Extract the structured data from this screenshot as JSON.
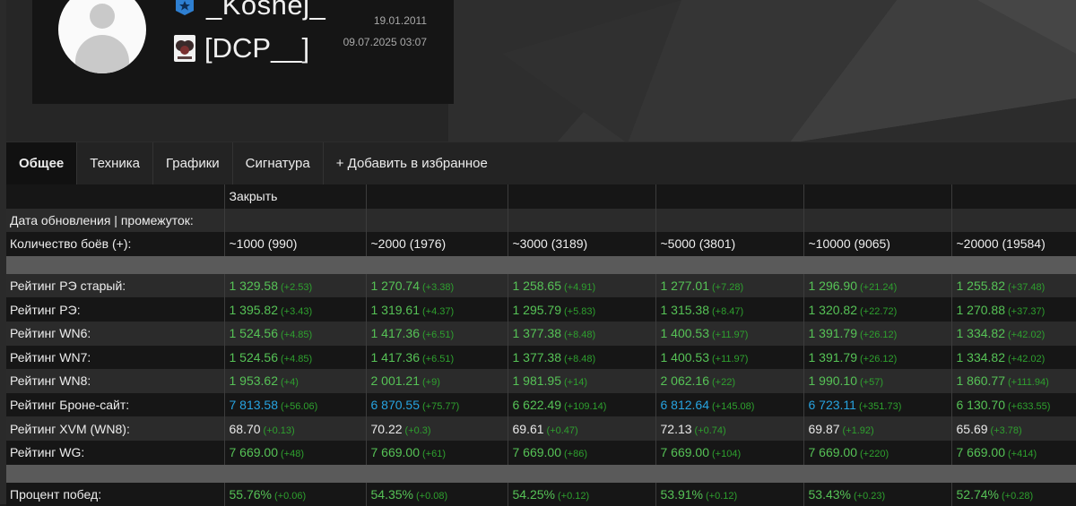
{
  "profile": {
    "nickname": "_Koshej_",
    "clan": "[DCP__]",
    "reg_date": "19.01.2011",
    "last_battle": "09.07.2025 03:07"
  },
  "tabs": [
    "Общее",
    "Техника",
    "Графики",
    "Сигнатура",
    "+ Добавить в избранное"
  ],
  "table": {
    "close_label": "Закрыть",
    "update_label": "Дата обновления | промежуток:",
    "battles_label": "Количество боёв (+):",
    "periods": [
      "~1000 (990)",
      "~2000 (1976)",
      "~3000 (3189)",
      "~5000 (3801)",
      "~10000 (9065)",
      "~20000 (19584)"
    ],
    "rows": [
      {
        "label": "Рейтинг РЭ старый:",
        "cells": [
          {
            "v": "1 329.58",
            "d": "(+2.53)",
            "c": "green"
          },
          {
            "v": "1 270.74",
            "d": "(+3.38)",
            "c": "green"
          },
          {
            "v": "1 258.65",
            "d": "(+4.91)",
            "c": "green"
          },
          {
            "v": "1 277.01",
            "d": "(+7.28)",
            "c": "green"
          },
          {
            "v": "1 296.90",
            "d": "(+21.24)",
            "c": "green"
          },
          {
            "v": "1 255.82",
            "d": "(+37.48)",
            "c": "green"
          }
        ]
      },
      {
        "label": "Рейтинг РЭ:",
        "cells": [
          {
            "v": "1 395.82",
            "d": "(+3.43)",
            "c": "green"
          },
          {
            "v": "1 319.61",
            "d": "(+4.37)",
            "c": "green"
          },
          {
            "v": "1 295.79",
            "d": "(+5.83)",
            "c": "green"
          },
          {
            "v": "1 315.38",
            "d": "(+8.47)",
            "c": "green"
          },
          {
            "v": "1 320.82",
            "d": "(+22.72)",
            "c": "green"
          },
          {
            "v": "1 270.88",
            "d": "(+37.37)",
            "c": "green"
          }
        ]
      },
      {
        "label": "Рейтинг WN6:",
        "cells": [
          {
            "v": "1 524.56",
            "d": "(+4.85)",
            "c": "green"
          },
          {
            "v": "1 417.36",
            "d": "(+6.51)",
            "c": "green"
          },
          {
            "v": "1 377.38",
            "d": "(+8.48)",
            "c": "green"
          },
          {
            "v": "1 400.53",
            "d": "(+11.97)",
            "c": "green"
          },
          {
            "v": "1 391.79",
            "d": "(+26.12)",
            "c": "green"
          },
          {
            "v": "1 334.82",
            "d": "(+42.02)",
            "c": "green"
          }
        ]
      },
      {
        "label": "Рейтинг WN7:",
        "cells": [
          {
            "v": "1 524.56",
            "d": "(+4.85)",
            "c": "green"
          },
          {
            "v": "1 417.36",
            "d": "(+6.51)",
            "c": "green"
          },
          {
            "v": "1 377.38",
            "d": "(+8.48)",
            "c": "green"
          },
          {
            "v": "1 400.53",
            "d": "(+11.97)",
            "c": "green"
          },
          {
            "v": "1 391.79",
            "d": "(+26.12)",
            "c": "green"
          },
          {
            "v": "1 334.82",
            "d": "(+42.02)",
            "c": "green"
          }
        ]
      },
      {
        "label": "Рейтинг WN8:",
        "cells": [
          {
            "v": "1 953.62",
            "d": "(+4)",
            "c": "green"
          },
          {
            "v": "2 001.21",
            "d": "(+9)",
            "c": "green"
          },
          {
            "v": "1 981.95",
            "d": "(+14)",
            "c": "green"
          },
          {
            "v": "2 062.16",
            "d": "(+22)",
            "c": "green"
          },
          {
            "v": "1 990.10",
            "d": "(+57)",
            "c": "green"
          },
          {
            "v": "1 860.77",
            "d": "(+111.94)",
            "c": "green"
          }
        ]
      },
      {
        "label": "Рейтинг Броне-сайт:",
        "cells": [
          {
            "v": "7 813.58",
            "d": "(+56.06)",
            "c": "blue"
          },
          {
            "v": "6 870.55",
            "d": "(+75.77)",
            "c": "blue"
          },
          {
            "v": "6 622.49",
            "d": "(+109.14)",
            "c": "green"
          },
          {
            "v": "6 812.64",
            "d": "(+145.08)",
            "c": "blue"
          },
          {
            "v": "6 723.11",
            "d": "(+351.73)",
            "c": "blue"
          },
          {
            "v": "6 130.70",
            "d": "(+633.55)",
            "c": "green"
          }
        ]
      },
      {
        "label": "Рейтинг XVM (WN8):",
        "cells": [
          {
            "v": "68.70",
            "d": "(+0.13)",
            "c": "white"
          },
          {
            "v": "70.22",
            "d": "(+0.3)",
            "c": "white"
          },
          {
            "v": "69.61",
            "d": "(+0.47)",
            "c": "white"
          },
          {
            "v": "72.13",
            "d": "(+0.74)",
            "c": "white"
          },
          {
            "v": "69.87",
            "d": "(+1.92)",
            "c": "white"
          },
          {
            "v": "65.69",
            "d": "(+3.78)",
            "c": "white"
          }
        ]
      },
      {
        "label": "Рейтинг WG:",
        "cells": [
          {
            "v": "7 669.00",
            "d": "(+48)",
            "c": "green"
          },
          {
            "v": "7 669.00",
            "d": "(+61)",
            "c": "green"
          },
          {
            "v": "7 669.00",
            "d": "(+86)",
            "c": "green"
          },
          {
            "v": "7 669.00",
            "d": "(+104)",
            "c": "green"
          },
          {
            "v": "7 669.00",
            "d": "(+220)",
            "c": "green"
          },
          {
            "v": "7 669.00",
            "d": "(+414)",
            "c": "green"
          }
        ]
      }
    ],
    "winrate": {
      "label": "Процент побед:",
      "cells": [
        {
          "v": "55.76%",
          "d": "(+0.06)",
          "c": "green"
        },
        {
          "v": "54.35%",
          "d": "(+0.08)",
          "c": "green"
        },
        {
          "v": "54.25%",
          "d": "(+0.12)",
          "c": "green"
        },
        {
          "v": "53.91%",
          "d": "(+0.12)",
          "c": "green"
        },
        {
          "v": "53.43%",
          "d": "(+0.23)",
          "c": "green"
        },
        {
          "v": "52.74%",
          "d": "(+0.28)",
          "c": "green"
        }
      ]
    }
  },
  "colors": {
    "green": "#56c256",
    "blue": "#27a3e0",
    "delta": "#2ea02e"
  }
}
